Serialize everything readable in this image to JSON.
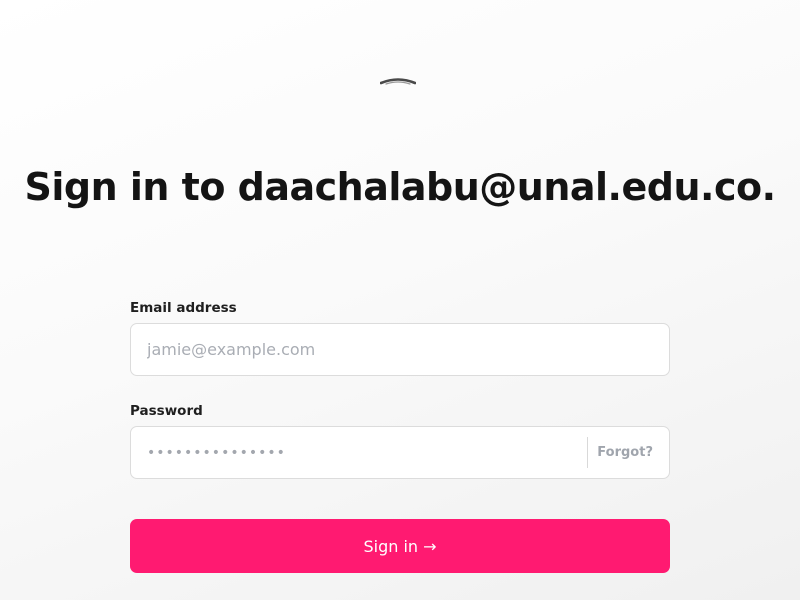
{
  "colors": {
    "accent": "#ff1a71",
    "title": "#141414",
    "placeholder": "#a9adb4",
    "border": "#dcdcdc"
  },
  "logo": {
    "icon": "logo-arc-icon"
  },
  "heading": {
    "title": "Sign in to daachalabu@unal.edu.co."
  },
  "form": {
    "email": {
      "label": "Email address",
      "placeholder": "jamie@example.com",
      "value": ""
    },
    "password": {
      "label": "Password",
      "placeholder": "•••••••••••••••",
      "forgot_label": "Forgot?"
    },
    "submit_label": "Sign in →"
  }
}
